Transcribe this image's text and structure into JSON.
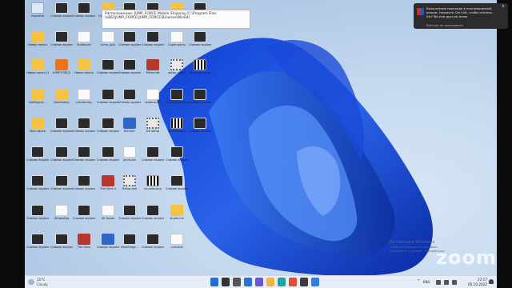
{
  "tooltip": {
    "text": "Расположение: JUMP_FORCE Mobile Shipping (C:\\Program Files (x86)\\JUMP_FORCE\\JUMP_FORCE\\Binaries\\Win64)"
  },
  "notification": {
    "text": "Выполнение перехода в полноэкранный режим. Нажмите Ctrl+Alt, чтобы отвлечь Alt+Tab или другую меню",
    "footer": "Больше не показывать",
    "close": "×"
  },
  "activation": {
    "title": "Активация Windows",
    "subtitle": "Чтобы активировать Windows, перейдите в раздел «Параметры»."
  },
  "zoom_watermark": "zoom",
  "weather": {
    "temp": "11°C",
    "condition": "Cloudy"
  },
  "tray": {
    "lang": "ENG",
    "time": "22:17",
    "date": "05.10.2022"
  },
  "desktop_icons": [
    {
      "label": "Корзина",
      "kind": "recycle"
    },
    {
      "label": "Новая папка",
      "kind": "folder"
    },
    {
      "label": "Новая папка (2)",
      "kind": "folder"
    },
    {
      "label": "tekPaypro...",
      "kind": "folder"
    },
    {
      "label": "Моя папка",
      "kind": "folder"
    },
    {
      "label": "Снимок экрана 2022...",
      "kind": "shot"
    },
    {
      "label": "Снимок экрана 2022...",
      "kind": "shot"
    },
    {
      "label": "Снимок экрана 2022...",
      "kind": "shot"
    },
    {
      "label": "Снимок экрана 2022...",
      "kind": "shot"
    },
    {
      "label": "Снимок экрана 2022...",
      "kind": "shot"
    },
    {
      "label": "Снимок экрана 2022...",
      "kind": "shot"
    },
    {
      "label": "JUMP FORCE",
      "kind": "orange"
    },
    {
      "label": "Doomsday",
      "kind": "folder"
    },
    {
      "label": "Снимок экрана 2022...",
      "kind": "shot"
    },
    {
      "label": "Снимок экрана 2022...",
      "kind": "shot"
    },
    {
      "label": "Снимок экрана 2022...",
      "kind": "shot"
    },
    {
      "label": "WhatsApp",
      "kind": "doc"
    },
    {
      "label": "Снимок экрана 2022...",
      "kind": "shot"
    },
    {
      "label": "Снимок экрана 2022...",
      "kind": "shot"
    },
    {
      "label": "dudley.txt",
      "kind": "doc"
    },
    {
      "label": "Новая папка",
      "kind": "folder"
    },
    {
      "label": "private.log",
      "kind": "doc"
    },
    {
      "label": "Снимок экрана 2022...",
      "kind": "shot"
    },
    {
      "label": "Снимок экрана 2022...",
      "kind": "shot"
    },
    {
      "label": "Снимок экрана 2022...",
      "kind": "shot"
    },
    {
      "label": "Снимок экрана 2022...",
      "kind": "shot"
    },
    {
      "label": "The Sims",
      "kind": "red"
    },
    {
      "label": "Новая папка",
      "kind": "folder"
    },
    {
      "label": "jump_upd",
      "kind": "doc"
    },
    {
      "label": "Снимок экрана 2022...",
      "kind": "shot"
    },
    {
      "label": "Снимок экрана 2022...",
      "kind": "shot"
    },
    {
      "label": "Снимок экрана 2022...",
      "kind": "shot"
    },
    {
      "label": "Снимок экрана 2022...",
      "kind": "shot"
    },
    {
      "label": "The Sims 4",
      "kind": "red"
    },
    {
      "label": "All Saves",
      "kind": "doc"
    },
    {
      "label": "Снимок экрана 2022...",
      "kind": "blueapp"
    },
    {
      "label": "Снимок экрана 2022...",
      "kind": "shot"
    },
    {
      "label": "Снимок экрана 2022...",
      "kind": "shot"
    },
    {
      "label": "Снимок экрана 2022...",
      "kind": "shot"
    },
    {
      "label": "Снимок экрана 2022...",
      "kind": "shot"
    },
    {
      "label": "Blender",
      "kind": "blueapp"
    },
    {
      "label": "jarvis.txt",
      "kind": "doc"
    },
    {
      "label": "Setup.exe",
      "kind": "gear"
    },
    {
      "label": "Снимок экрана 2022...",
      "kind": "shot"
    },
    {
      "label": "HeroForge...",
      "kind": "shot"
    },
    {
      "label": "Снимок экрана 2022...",
      "kind": "shot"
    },
    {
      "label": "Снимок экрана 2022...",
      "kind": "shot"
    },
    {
      "label": "Minecraft",
      "kind": "red"
    },
    {
      "label": "readme.txt",
      "kind": "doc"
    },
    {
      "label": "DX setup",
      "kind": "gear"
    },
    {
      "label": "Снимок экрана 2022...",
      "kind": "shot"
    },
    {
      "label": "qr-code.png",
      "kind": "qr"
    },
    {
      "label": "Снимок экрана 2022...",
      "kind": "shot"
    },
    {
      "label": "Снимок экрана 2022...",
      "kind": "shot"
    },
    {
      "label": "Ярлык",
      "kind": "folder"
    },
    {
      "label": "Скриншоты",
      "kind": "doc"
    },
    {
      "label": "setup_crack",
      "kind": "gear"
    },
    {
      "label": "Снимок экрана 2022...",
      "kind": "shot"
    },
    {
      "label": "qr-code.png",
      "kind": "qr"
    },
    {
      "label": "Снимок экрана 2022...",
      "kind": "shot"
    },
    {
      "label": "Снимок экрана 2022...",
      "kind": "shot"
    },
    {
      "label": "studio.lnk",
      "kind": "folder"
    },
    {
      "label": "uninstall",
      "kind": "doc"
    },
    {
      "label": "Снимок экрана 2022...",
      "kind": "shot"
    },
    {
      "label": "Снимок экрана 2022...",
      "kind": "shot"
    },
    {
      "label": "qr-qrmark.png",
      "kind": "qr"
    },
    {
      "label": "Снимок экрана 2022...",
      "kind": "shot"
    },
    {
      "label": "Снимок экрана 2022...",
      "kind": "shot"
    }
  ],
  "taskbar_apps": [
    "start-icon",
    "search-icon",
    "taskview-icon",
    "widgets-icon",
    "chat-icon",
    "explorer-icon",
    "edge-icon",
    "chrome-icon",
    "store-icon",
    "app-icon"
  ],
  "colors": {
    "wallpaper_blue": "#1f4fd6",
    "taskbar": "#e6edf6",
    "zoom": "#f3f6fa"
  }
}
